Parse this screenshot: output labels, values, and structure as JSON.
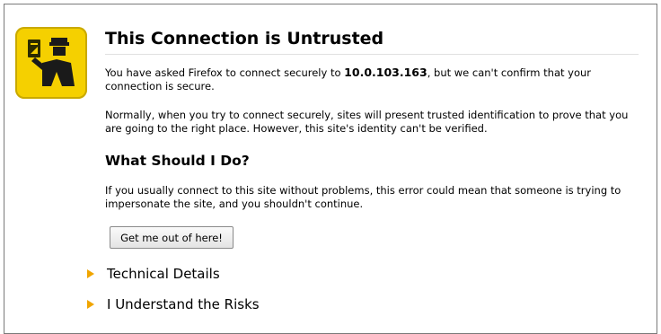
{
  "page": {
    "title": "This Connection is Untrusted",
    "intro_before": "You have asked Firefox to connect securely to ",
    "host": "10.0.103.163",
    "intro_after": ", but we can't confirm that your connection is secure.",
    "normal_text": "Normally, when you try to connect securely, sites will present trusted identification to prove that you are going to the right place. However, this site's identity can't be verified.",
    "what_heading": "What Should I Do?",
    "what_text": "If you usually connect to this site without problems, this error could mean that someone is trying to impersonate the site, and you shouldn't continue.",
    "getout_button": "Get me out of here!",
    "technical_details": "Technical Details",
    "understand_risks": "I Understand the Risks"
  },
  "icons": {
    "badge": "security-officer-icon",
    "expander": "triangle-right-icon"
  },
  "colors": {
    "badge_yellow": "#f5d000",
    "expander_arrow": "#f0a500"
  }
}
